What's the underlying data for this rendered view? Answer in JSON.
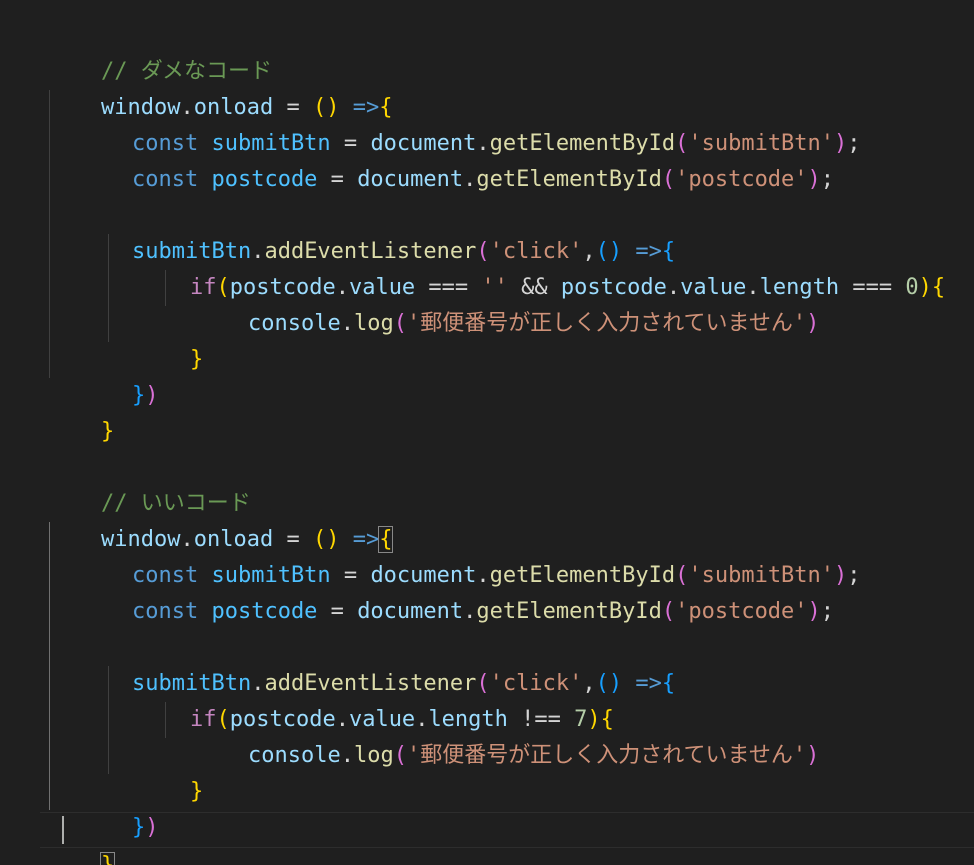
{
  "theme": {
    "background": "#1f1f1f",
    "comment": "#6a9955",
    "variable": "#9cdcfe",
    "constant": "#4fc1ff",
    "keyword": "#569cd6",
    "control": "#c586c0",
    "function": "#dcdcaa",
    "string": "#ce9178",
    "number": "#b5cea8",
    "operator": "#d4d4d4",
    "bracket_level_1": "#ffd700",
    "bracket_level_2": "#da70d6",
    "bracket_level_3": "#179fff"
  },
  "code": {
    "bad": {
      "comment": "// ダメなコード",
      "condition": {
        "empty_string": "''",
        "zero": "0"
      },
      "message": "'郵便番号が正しく入力されていません'"
    },
    "good": {
      "comment": "// いいコード",
      "condition": {
        "seven": "7"
      },
      "message": "'郵便番号が正しく入力されていません'"
    },
    "common": {
      "window": "window",
      "onload": "onload",
      "const": "const",
      "submitBtn": "submitBtn",
      "postcode": "postcode",
      "document": "document",
      "getElementById": "getElementById",
      "id_submitBtn": "'submitBtn'",
      "id_postcode": "'postcode'",
      "addEventListener": "addEventListener",
      "click": "'click'",
      "if": "if",
      "value": "value",
      "length": "length",
      "console": "console",
      "log": "log"
    }
  }
}
